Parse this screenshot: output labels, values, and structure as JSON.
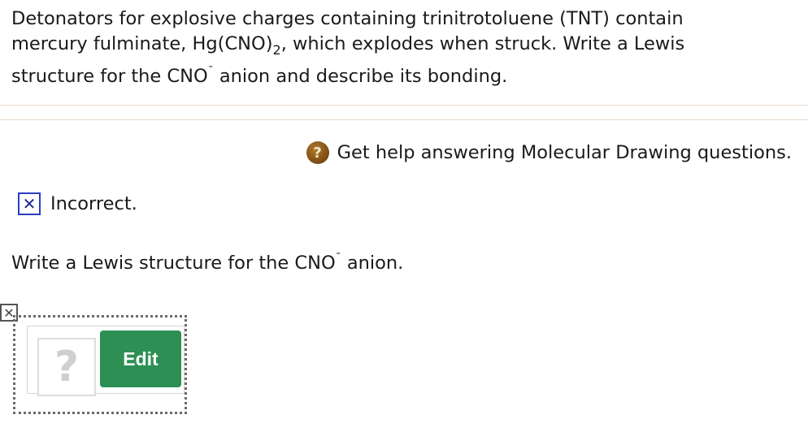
{
  "question": {
    "line1": "Detonators for explosive charges containing trinitrotoluene (TNT) contain",
    "line2_pre": "mercury fulminate, Hg(CNO)",
    "line2_sub": "2",
    "line2_post": ", which explodes when struck. Write a Lewis",
    "line3_pre": "structure for the CNO",
    "line3_sup": "¯",
    "line3_post": " anion and describe its bonding."
  },
  "help": {
    "icon": "question-mark-icon",
    "icon_glyph": "?",
    "label": "Get help answering Molecular Drawing questions."
  },
  "status": {
    "icon": "x-icon",
    "icon_glyph": "✕",
    "label": "Incorrect."
  },
  "prompt": {
    "pre": "Write a Lewis structure for the CNO",
    "sup": "¯",
    "post": " anion."
  },
  "drawing": {
    "close_glyph": "✕",
    "placeholder_glyph": "?",
    "edit_label": "Edit",
    "edit_color": "#2d8f53"
  },
  "colors": {
    "divider": "#e6d7c8",
    "status_border": "#2a3fbf",
    "help_icon": "#7a4a12"
  }
}
